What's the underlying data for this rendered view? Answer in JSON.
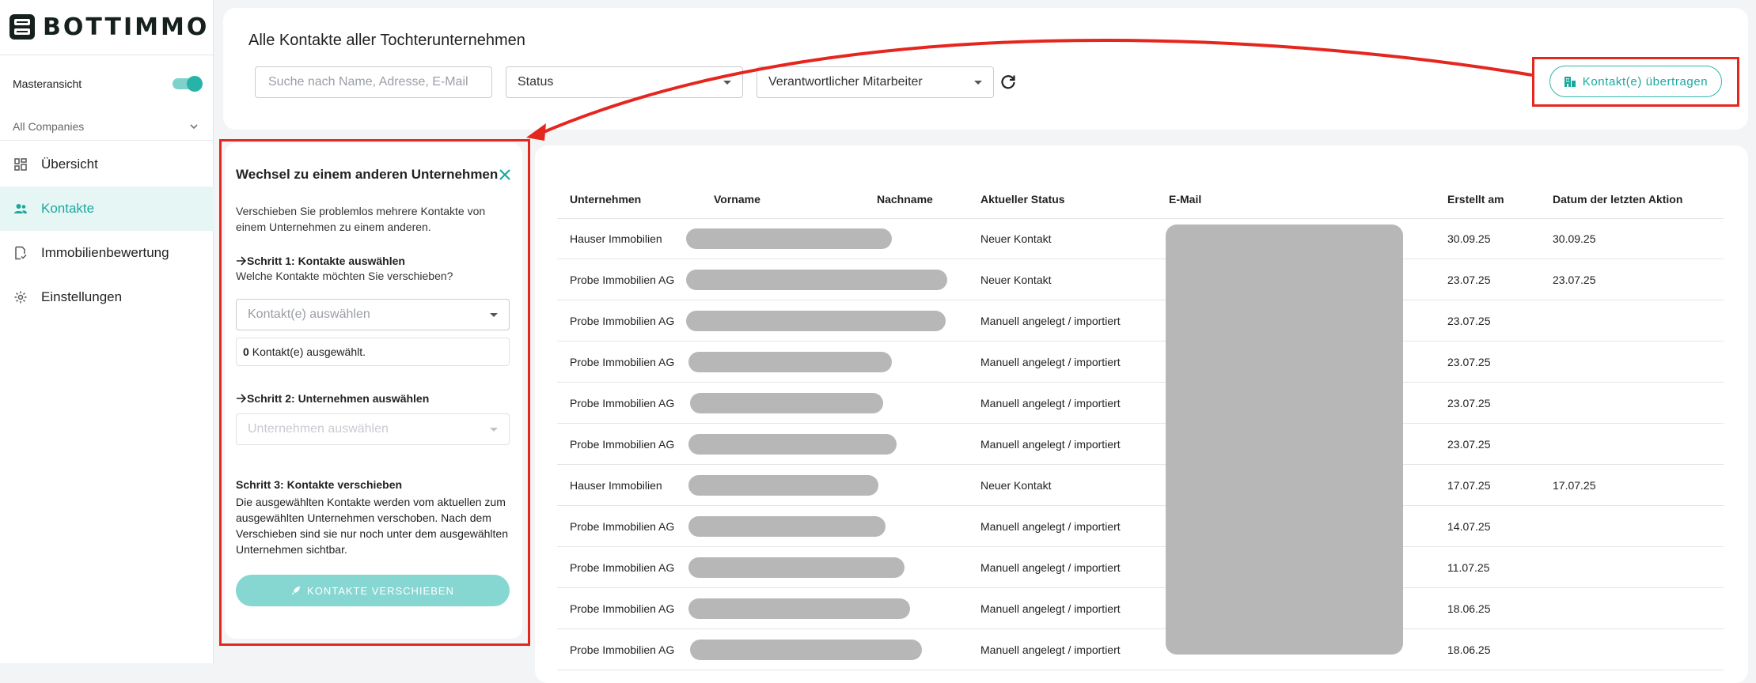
{
  "brand": {
    "name": "BOTTIMMO"
  },
  "sidebar": {
    "master_label": "Masteransicht",
    "master_on": true,
    "companies_label": "All Companies",
    "items": [
      {
        "label": "Übersicht",
        "icon": "dashboard-icon",
        "active": false
      },
      {
        "label": "Kontakte",
        "icon": "contacts-icon",
        "active": true
      },
      {
        "label": "Immobilienbewertung",
        "icon": "valuation-icon",
        "active": false
      },
      {
        "label": "Einstellungen",
        "icon": "gear-icon",
        "active": false
      }
    ]
  },
  "header": {
    "title": "Alle Kontakte aller Tochterunternehmen",
    "search_placeholder": "Suche nach Name, Adresse, E-Mail",
    "status_label": "Status",
    "employee_label": "Verantwortlicher Mitarbeiter",
    "transfer_button": "Kontakt(e) übertragen"
  },
  "panel": {
    "title": "Wechsel zu einem anderen Unternehmen",
    "intro": "Verschieben Sie problemlos mehrere Kontakte von einem Unternehmen zu einem anderen.",
    "step1_title": "Schritt 1: Kontakte auswählen",
    "step1_question": "Welche Kontakte möchten Sie verschieben?",
    "contacts_placeholder": "Kontakt(e) auswählen",
    "count_number": "0",
    "count_text": "Kontakt(e) ausgewählt.",
    "step2_title": "Schritt 2: Unternehmen auswählen",
    "company_placeholder": "Unternehmen auswählen",
    "step3_title": "Schritt 3: Kontakte verschieben",
    "step3_text": "Die ausgewählten Kontakte werden vom aktuellen zum ausgewählten Unternehmen verschoben. Nach dem Verschieben sind sie nur noch unter dem ausgewählten Unternehmen sichtbar.",
    "move_button": "KONTAKTE VERSCHIEBEN"
  },
  "table": {
    "columns": [
      "Unternehmen",
      "Vorname",
      "Nachname",
      "Aktueller Status",
      "E-Mail",
      "Erstellt am",
      "Datum der letzten Aktion"
    ],
    "rows": [
      {
        "company": "Hauser Immobilien",
        "status": "Neuer Kontakt",
        "created": "30.09.25",
        "last_action": "30.09.25"
      },
      {
        "company": "Probe Immobilien AG",
        "status": "Neuer Kontakt",
        "created": "23.07.25",
        "last_action": "23.07.25"
      },
      {
        "company": "Probe Immobilien AG",
        "status": "Manuell angelegt / importiert",
        "created": "23.07.25",
        "last_action": ""
      },
      {
        "company": "Probe Immobilien AG",
        "status": "Manuell angelegt / importiert",
        "created": "23.07.25",
        "last_action": ""
      },
      {
        "company": "Probe Immobilien AG",
        "status": "Manuell angelegt / importiert",
        "created": "23.07.25",
        "last_action": ""
      },
      {
        "company": "Probe Immobilien AG",
        "status": "Manuell angelegt / importiert",
        "created": "23.07.25",
        "last_action": ""
      },
      {
        "company": "Hauser Immobilien",
        "status": "Neuer Kontakt",
        "created": "17.07.25",
        "last_action": "17.07.25"
      },
      {
        "company": "Probe Immobilien AG",
        "status": "Manuell angelegt / importiert",
        "created": "14.07.25",
        "last_action": ""
      },
      {
        "company": "Probe Immobilien AG",
        "status": "Manuell angelegt / importiert",
        "created": "11.07.25",
        "last_action": ""
      },
      {
        "company": "Probe Immobilien AG",
        "status": "Manuell angelegt / importiert",
        "created": "18.06.25",
        "last_action": ""
      },
      {
        "company": "Probe Immobilien AG",
        "status": "Manuell angelegt / importiert",
        "created": "18.06.25",
        "last_action": ""
      }
    ]
  },
  "colors": {
    "accent": "#27b3a8",
    "accent_light": "#86d7d1",
    "highlight": "#e5261e",
    "redaction": "#b7b7b7"
  }
}
